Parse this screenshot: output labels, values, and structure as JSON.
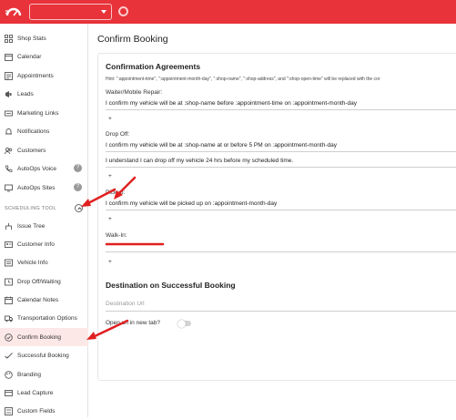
{
  "topbar": {
    "shop_select_value": "",
    "logo_icon": "speedometer-logo-icon",
    "settings_icon": "gear-icon",
    "accent_color": "#e8333a"
  },
  "sidebar": {
    "items": [
      {
        "label": "Shop Stats",
        "icon": "grid-icon"
      },
      {
        "label": "Calendar",
        "icon": "calendar-icon"
      },
      {
        "label": "Appointments",
        "icon": "list-icon"
      },
      {
        "label": "Leads",
        "icon": "megaphone-icon"
      },
      {
        "label": "Marketing Links",
        "icon": "keyboard-icon"
      },
      {
        "label": "Notifications",
        "icon": "bell-icon"
      },
      {
        "label": "Customers",
        "icon": "users-icon"
      },
      {
        "label": "AutoOps Voice",
        "icon": "phone-icon",
        "help": "?"
      },
      {
        "label": "AutoOps Sites",
        "icon": "monitor-icon",
        "help": "?"
      }
    ],
    "section_label": "SCHEDULING TOOL",
    "scheduling_items": [
      {
        "label": "Issue Tree",
        "icon": "tree-icon"
      },
      {
        "label": "Customer Info",
        "icon": "id-card-icon"
      },
      {
        "label": "Vehicle Info",
        "icon": "car-icon"
      },
      {
        "label": "Drop Off/Waiting",
        "icon": "clock-icon"
      },
      {
        "label": "Calendar Notes",
        "icon": "calendar-note-icon"
      },
      {
        "label": "Transportation Options",
        "icon": "truck-icon"
      },
      {
        "label": "Confirm Booking",
        "icon": "badge-check-icon",
        "active": true
      },
      {
        "label": "Successful Booking",
        "icon": "checkmark-icon"
      },
      {
        "label": "Branding",
        "icon": "palette-icon"
      },
      {
        "label": "Lead Capture",
        "icon": "card-icon"
      },
      {
        "label": "Custom Fields",
        "icon": "form-icon"
      }
    ]
  },
  "main": {
    "page_title": "Confirm Booking",
    "agreements": {
      "title": "Confirmation Agreements",
      "hint": "Hint: \":appointment-time\", \":appointment-month-day\", \":shop-name\", \":shop-address\", and \":shop-open-time\" will be replaced with the cor",
      "waiter_label": "Waiter/Mobile Repair:",
      "waiter_value": "I confirm my vehicle will be at :shop-name before :appointment-time on :appointment-month-day",
      "dropoff_label": "Drop Off:",
      "dropoff_value_1": "I confirm my vehicle will be at :shop-name at or before 5 PM on :appointment-month-day",
      "dropoff_value_2": "I understand I can drop off my vehicle 24 hrs before my scheduled time.",
      "pickup_label": "Pickup:",
      "pickup_value": "I confirm my vehicle will be picked up on :appointment-month-day",
      "walkin_label": "Walk-In:",
      "add_symbol": "+"
    },
    "destination": {
      "title": "Destination on Successful Booking",
      "url_placeholder": "Destination Url",
      "new_tab_label": "Open url in new tab?",
      "new_tab_enabled": false
    }
  },
  "annotations": {
    "arrow_color": "#e02020"
  }
}
